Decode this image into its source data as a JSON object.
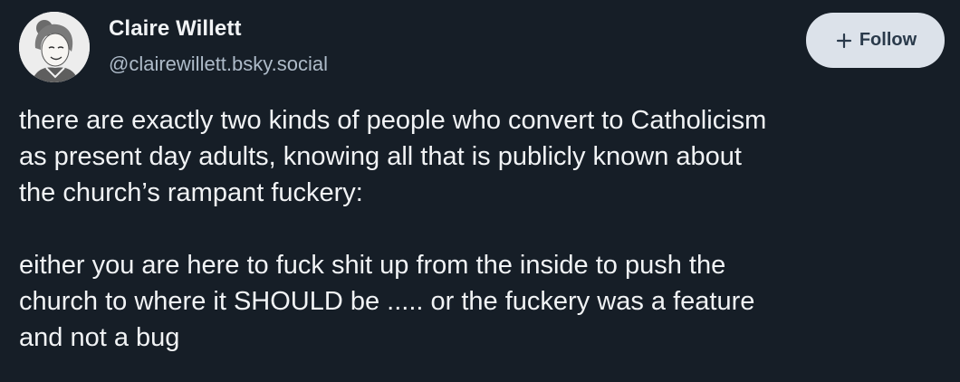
{
  "author": {
    "display_name": "Claire Willett",
    "handle": "@clairewillett.bsky.social",
    "avatar_icon": "avatar-illustration-icon"
  },
  "follow_button": {
    "icon": "plus-icon",
    "label": "Follow"
  },
  "post": {
    "paragraphs": [
      "there are exactly two kinds of people who convert to Catholicism\nas present day adults, knowing all that is publicly known about\nthe church’s rampant fuckery:",
      "either you are here to fuck shit up from the inside to push the\nchurch to where it SHOULD be ..... or the fuckery was a feature\nand not a bug"
    ]
  },
  "colors": {
    "background": "#161e27",
    "text_primary": "#f1f3f5",
    "text_secondary": "#aebbc9",
    "button_background": "#dce2ea",
    "button_text": "#2a3a4b"
  }
}
